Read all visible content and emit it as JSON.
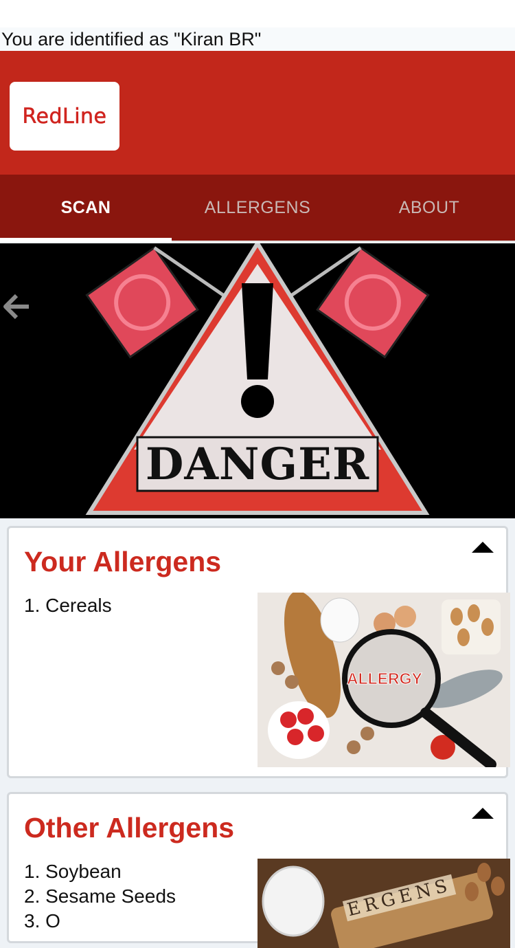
{
  "identified_text": "You are identified as \"Kiran BR\"",
  "logo_text": "RedLine",
  "tabs": [
    {
      "label": "SCAN",
      "active": true
    },
    {
      "label": "ALLERGENS",
      "active": false
    },
    {
      "label": "ABOUT",
      "active": false
    }
  ],
  "banner": {
    "sign_text": "DANGER",
    "back_icon": "arrow-left-icon"
  },
  "your_allergens": {
    "title": "Your Allergens",
    "items": [
      "1.  Cereals"
    ],
    "image_text": "ALLERGY"
  },
  "other_allergens": {
    "title": "Other Allergens",
    "items": [
      "1.  Soybean",
      "2.  Sesame Seeds",
      "3.  O"
    ],
    "image_text": "ERGENS"
  },
  "colors": {
    "header_red": "#c2271b",
    "tabbar_dark_red": "#8a160e",
    "title_red": "#cc2a1f"
  }
}
